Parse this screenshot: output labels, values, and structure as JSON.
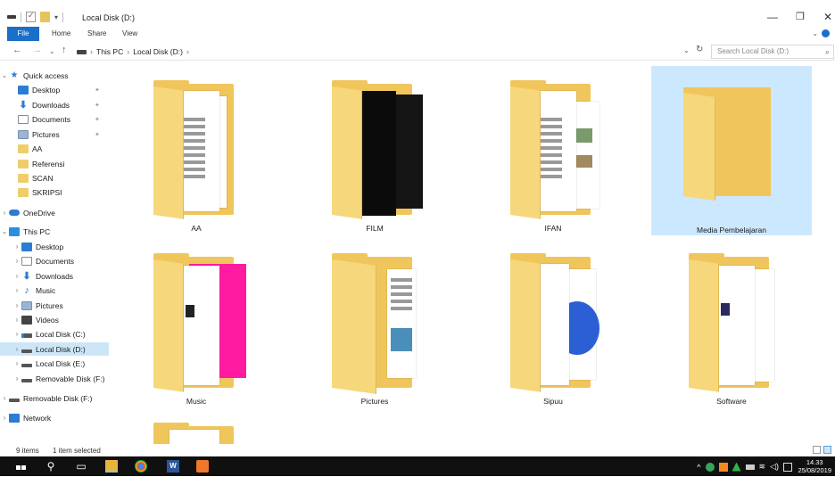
{
  "window": {
    "title": "Local Disk (D:)",
    "controls": {
      "minimize": "—",
      "maximize": "❐",
      "close": "✕"
    }
  },
  "ribbon": {
    "tabs": [
      {
        "label": "File",
        "active": true
      },
      {
        "label": "Home"
      },
      {
        "label": "Share"
      },
      {
        "label": "View"
      }
    ]
  },
  "address": {
    "crumbs": [
      "This PC",
      "Local Disk (D:)"
    ],
    "search_placeholder": "Search Local Disk (D:)"
  },
  "nav": {
    "quick_access": {
      "label": "Quick access",
      "items": [
        {
          "label": "Desktop",
          "icon": "desktop-icon",
          "pinned": true
        },
        {
          "label": "Downloads",
          "icon": "download-icon",
          "pinned": true
        },
        {
          "label": "Documents",
          "icon": "documents-icon",
          "pinned": true
        },
        {
          "label": "Pictures",
          "icon": "pictures-icon",
          "pinned": true
        },
        {
          "label": "AA",
          "icon": "folder-icon"
        },
        {
          "label": "Referensi",
          "icon": "folder-icon"
        },
        {
          "label": "SCAN",
          "icon": "folder-icon"
        },
        {
          "label": "SKRIPSI",
          "icon": "folder-icon"
        }
      ]
    },
    "onedrive": {
      "label": "OneDrive"
    },
    "this_pc": {
      "label": "This PC",
      "items": [
        {
          "label": "Desktop"
        },
        {
          "label": "Documents"
        },
        {
          "label": "Downloads"
        },
        {
          "label": "Music"
        },
        {
          "label": "Pictures"
        },
        {
          "label": "Videos"
        },
        {
          "label": "Local Disk (C:)"
        },
        {
          "label": "Local Disk (D:)",
          "selected": true
        },
        {
          "label": "Local Disk (E:)"
        },
        {
          "label": "Removable Disk (F:)"
        }
      ]
    },
    "removable": {
      "label": "Removable Disk (F:)"
    },
    "network": {
      "label": "Network"
    }
  },
  "folders": [
    {
      "name": "AA"
    },
    {
      "name": "FILM"
    },
    {
      "name": "IFAN"
    },
    {
      "name": "Media Pembelajaran",
      "selected": true
    },
    {
      "name": "Music"
    },
    {
      "name": "Pictures"
    },
    {
      "name": "Sipuu"
    },
    {
      "name": "Software"
    }
  ],
  "status": {
    "items": "9 items",
    "selection": "1 item selected"
  },
  "taskbar": {
    "time": "14.33",
    "date": "25/08/2019",
    "pinned": [
      "start",
      "search",
      "task-view",
      "file-explorer",
      "chrome",
      "word",
      "photos"
    ]
  },
  "colors": {
    "accent": "#1a6fc9",
    "selection": "#cce8ff",
    "folder": "#f0c65c",
    "taskbar": "#101010"
  }
}
